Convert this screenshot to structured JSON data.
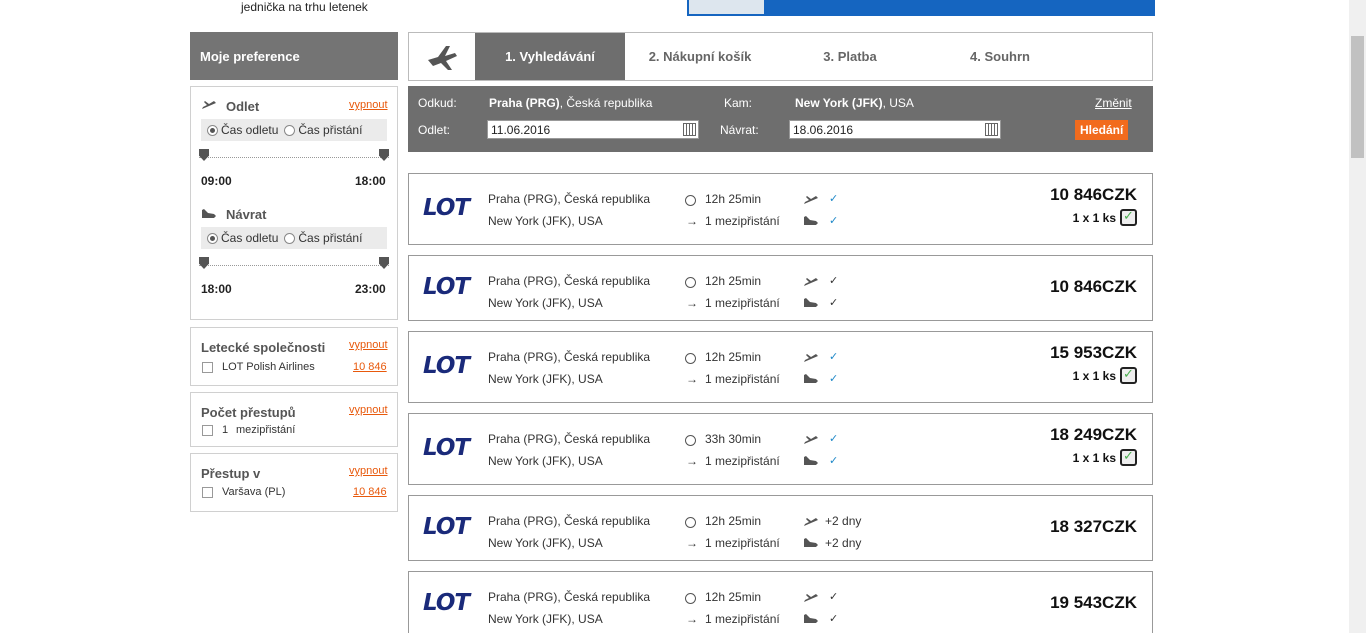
{
  "header": {
    "tagline": "jednička na trhu letenek"
  },
  "sidebar": {
    "title": "Moje preference",
    "departure": {
      "label": "Odlet",
      "off": "vypnout",
      "opt1": "Čas odletu",
      "opt2": "Čas přistání",
      "min": "09:00",
      "max": "18:00"
    },
    "return": {
      "label": "Návrat",
      "opt1": "Čas odletu",
      "opt2": "Čas přistání",
      "min": "18:00",
      "max": "23:00"
    },
    "airlines": {
      "title": "Letecké společnosti",
      "off": "vypnout",
      "item": "LOT Polish Airlines",
      "count": "10 846"
    },
    "stops": {
      "title": "Počet přestupů",
      "off": "vypnout",
      "num": "1",
      "item": "mezipřistání"
    },
    "transfer": {
      "title": "Přestup v",
      "off": "vypnout",
      "item": "Varšava (PL)",
      "count": "10 846"
    }
  },
  "steps": [
    "1. Vyhledávání",
    "2. Nákupní košík",
    "3. Platba",
    "4. Souhrn"
  ],
  "search": {
    "from_label": "Odkud:",
    "from_city": "Praha (PRG)",
    "from_country": ", Česká republika",
    "to_label": "Kam:",
    "to_city": "New York (JFK)",
    "to_country": ", USA",
    "change": "Změnit",
    "dep_label": "Odlet:",
    "dep_date": "11.06.2016",
    "ret_label": "Návrat:",
    "ret_date": "18.06.2016",
    "button": "Hledání"
  },
  "flights": [
    {
      "airline": "LOT",
      "from": "Praha (PRG), Česká republika",
      "to": "New York (JFK), USA",
      "duration": "12h 25min",
      "stops": "1 mezipřistání",
      "out": "✓",
      "back": "✓",
      "price": "10 846CZK",
      "bag": "1 x 1 ks"
    },
    {
      "airline": "LOT",
      "from": "Praha (PRG), Česká republika",
      "to": "New York (JFK), USA",
      "duration": "12h 25min",
      "stops": "1 mezipřistání",
      "out": "✓",
      "back": "✓",
      "price": "10 846CZK",
      "bag": ""
    },
    {
      "airline": "LOT",
      "from": "Praha (PRG), Česká republika",
      "to": "New York (JFK), USA",
      "duration": "12h 25min",
      "stops": "1 mezipřistání",
      "out": "✓",
      "back": "✓",
      "price": "15 953CZK",
      "bag": "1 x 1 ks"
    },
    {
      "airline": "LOT",
      "from": "Praha (PRG), Česká republika",
      "to": "New York (JFK), USA",
      "duration": "33h 30min",
      "stops": "1 mezipřistání",
      "out": "✓",
      "back": "✓",
      "price": "18 249CZK",
      "bag": "1 x 1 ks"
    },
    {
      "airline": "LOT",
      "from": "Praha (PRG), Česká republika",
      "to": "New York (JFK), USA",
      "duration": "12h 25min",
      "stops": "1 mezipřistání",
      "out": "+2 dny",
      "back": "+2 dny",
      "price": "18 327CZK",
      "bag": ""
    },
    {
      "airline": "LOT",
      "from": "Praha (PRG), Česká republika",
      "to": "New York (JFK), USA",
      "duration": "12h 25min",
      "stops": "1 mezipřistání",
      "out": "✓",
      "back": "✓",
      "price": "19 543CZK",
      "bag": ""
    }
  ],
  "colors": {
    "accent": "#f26b1d",
    "dark": "#6e6e6e",
    "check_blue": "#1e88c8",
    "lot_blue": "#1a2a7a"
  },
  "icons": {
    "logo": "plane-icon",
    "clock": "clock-icon",
    "takeoff": "takeoff-icon",
    "landing": "landing-icon",
    "calendar": "calendar-icon",
    "bag": "luggage-icon"
  }
}
